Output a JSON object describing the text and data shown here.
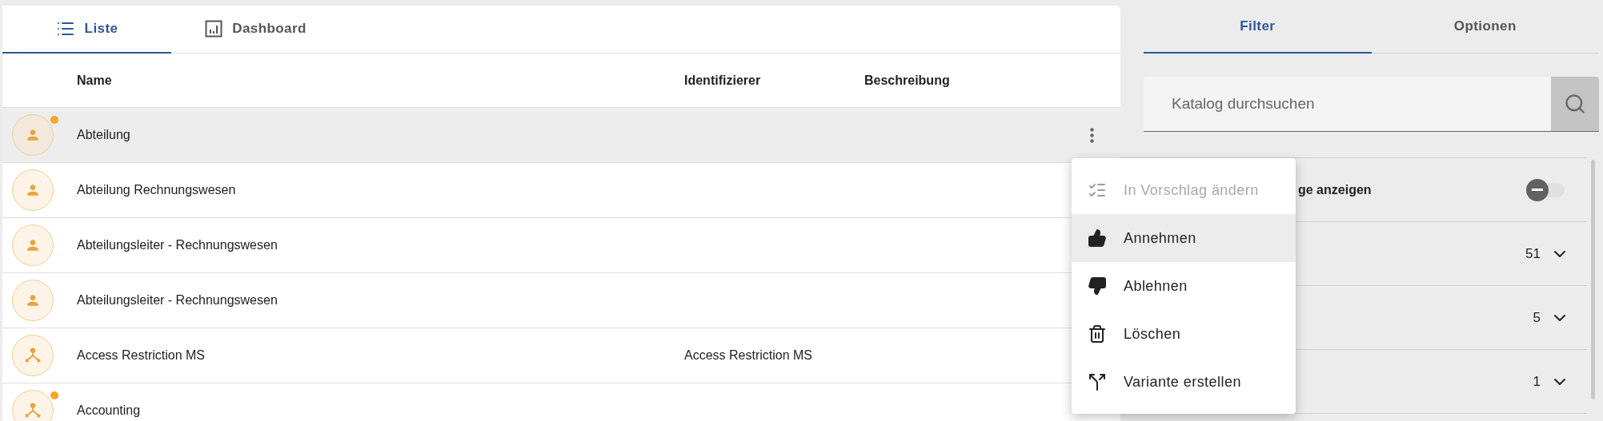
{
  "list_tabs": [
    {
      "label": "Liste",
      "kind": "list",
      "selected": true
    },
    {
      "label": "Dashboard",
      "kind": "chart",
      "selected": false
    }
  ],
  "table": {
    "columns": [
      "Name",
      "Identifizierer",
      "Beschreibung"
    ],
    "rows": [
      {
        "kind": "person",
        "name": "Abteilung",
        "marked": true,
        "selected": true
      },
      {
        "kind": "person",
        "name": "Abteilung Rechnungswesen",
        "marked": false,
        "selected": false
      },
      {
        "kind": "person",
        "name": "Abteilungsleiter - Rechnungswesen",
        "marked": false,
        "selected": false
      },
      {
        "kind": "person",
        "name": "Abteilungsleiter - Rechnungswesen",
        "marked": false,
        "selected": false
      },
      {
        "kind": "hierarchy",
        "name": "Access Restriction MS",
        "identifier": "Access Restriction MS",
        "marked": false,
        "selected": false
      },
      {
        "kind": "hierarchy",
        "name": "Accounting",
        "marked": true,
        "selected": false
      }
    ]
  },
  "context_menu": [
    {
      "kind": "proposal",
      "label": "In Vorschlag ändern",
      "disabled": true,
      "selected": false
    },
    {
      "kind": "accept",
      "label": "Annehmen",
      "disabled": false,
      "selected": true
    },
    {
      "kind": "reject",
      "label": "Ablehnen",
      "disabled": false,
      "selected": false
    },
    {
      "kind": "delete",
      "label": "Löschen",
      "disabled": false,
      "selected": false
    },
    {
      "kind": "variant",
      "label": "Variante erstellen",
      "disabled": false,
      "selected": false
    }
  ],
  "side_tabs": [
    {
      "label": "Filter",
      "selected": true
    },
    {
      "label": "Optionen",
      "selected": false
    }
  ],
  "search": {
    "placeholder": "Katalog durchsuchen"
  },
  "filters": [
    {
      "kind": "toggle",
      "label": "ge anzeigen",
      "on": false
    },
    {
      "kind": "count",
      "count": "51"
    },
    {
      "kind": "count",
      "count": "5"
    },
    {
      "kind": "count",
      "count": "1"
    }
  ]
}
